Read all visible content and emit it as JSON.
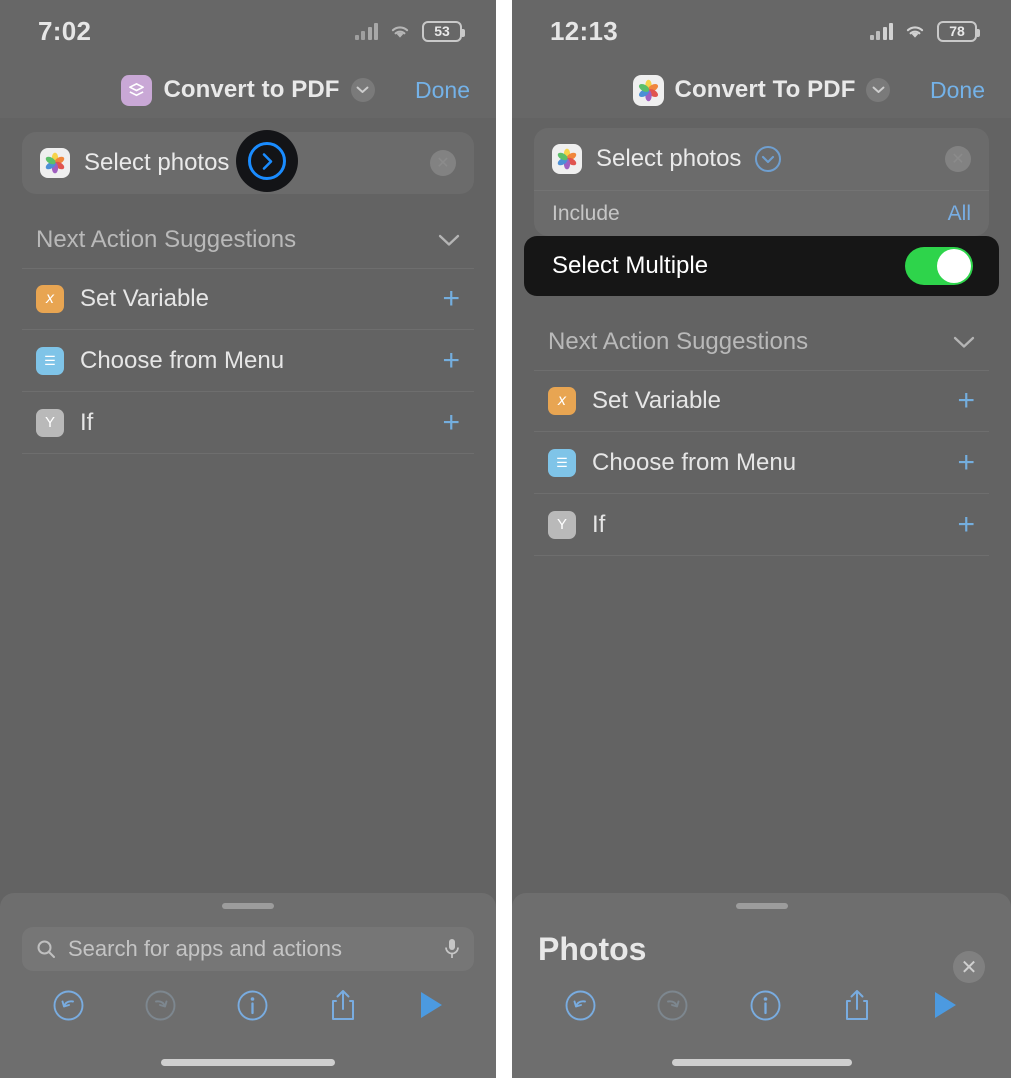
{
  "left": {
    "status": {
      "time": "7:02",
      "battery": "53",
      "wifi_icon": "wifi-icon",
      "cellular_icon": "cellular-bars-icon"
    },
    "nav": {
      "app_icon": "shortcuts-icon",
      "title": "Convert to PDF",
      "chevron_icon": "chevron-down-icon",
      "done_label": "Done"
    },
    "action": {
      "icon": "photos-icon",
      "label": "Select photos",
      "disclosure_icon": "chevron-right-circle-icon",
      "remove_icon": "x-circle-icon"
    },
    "suggestions": {
      "title": "Next Action Suggestions",
      "collapse_icon": "chevron-down-icon",
      "items": [
        {
          "label": "Set Variable",
          "glyph": "x",
          "color": "#e8a552",
          "add_icon": "plus-icon"
        },
        {
          "label": "Choose from Menu",
          "glyph": "☰",
          "color": "#7fc4e8",
          "add_icon": "plus-icon"
        },
        {
          "label": "If",
          "glyph": "Y",
          "color": "#b9b9b9",
          "add_icon": "plus-icon"
        }
      ]
    },
    "sheet": {
      "search_placeholder": "Search for apps and actions",
      "search_icon": "search-icon",
      "mic_icon": "microphone-icon"
    },
    "toolbar": [
      {
        "name": "undo-icon"
      },
      {
        "name": "redo-icon"
      },
      {
        "name": "info-icon"
      },
      {
        "name": "share-icon"
      },
      {
        "name": "play-icon"
      }
    ]
  },
  "right": {
    "status": {
      "time": "12:13",
      "battery": "78",
      "wifi_icon": "wifi-icon",
      "cellular_icon": "cellular-bars-icon"
    },
    "nav": {
      "app_icon": "photos-icon",
      "title": "Convert To PDF",
      "chevron_icon": "chevron-down-icon",
      "done_label": "Done"
    },
    "action": {
      "icon": "photos-icon",
      "label": "Select photos",
      "disclosure_icon": "chevron-down-circle-icon",
      "remove_icon": "x-circle-icon"
    },
    "include": {
      "label": "Include",
      "value": "All"
    },
    "toggle": {
      "label": "Select Multiple",
      "state": "on",
      "accent": "#2ed44b"
    },
    "suggestions": {
      "title": "Next Action Suggestions",
      "collapse_icon": "chevron-down-icon",
      "items": [
        {
          "label": "Set Variable",
          "glyph": "x",
          "color": "#e8a552",
          "add_icon": "plus-icon"
        },
        {
          "label": "Choose from Menu",
          "glyph": "☰",
          "color": "#7fc4e8",
          "add_icon": "plus-icon"
        },
        {
          "label": "If",
          "glyph": "Y",
          "color": "#b9b9b9",
          "add_icon": "plus-icon"
        }
      ]
    },
    "sheet": {
      "title": "Photos",
      "close_icon": "close-icon"
    },
    "toolbar": [
      {
        "name": "undo-icon"
      },
      {
        "name": "redo-icon"
      },
      {
        "name": "info-icon"
      },
      {
        "name": "share-icon"
      },
      {
        "name": "play-icon"
      }
    ]
  },
  "colors": {
    "accent_blue": "#74b2e8",
    "toggle_green": "#2ed44b",
    "page_bg": "#676767"
  }
}
